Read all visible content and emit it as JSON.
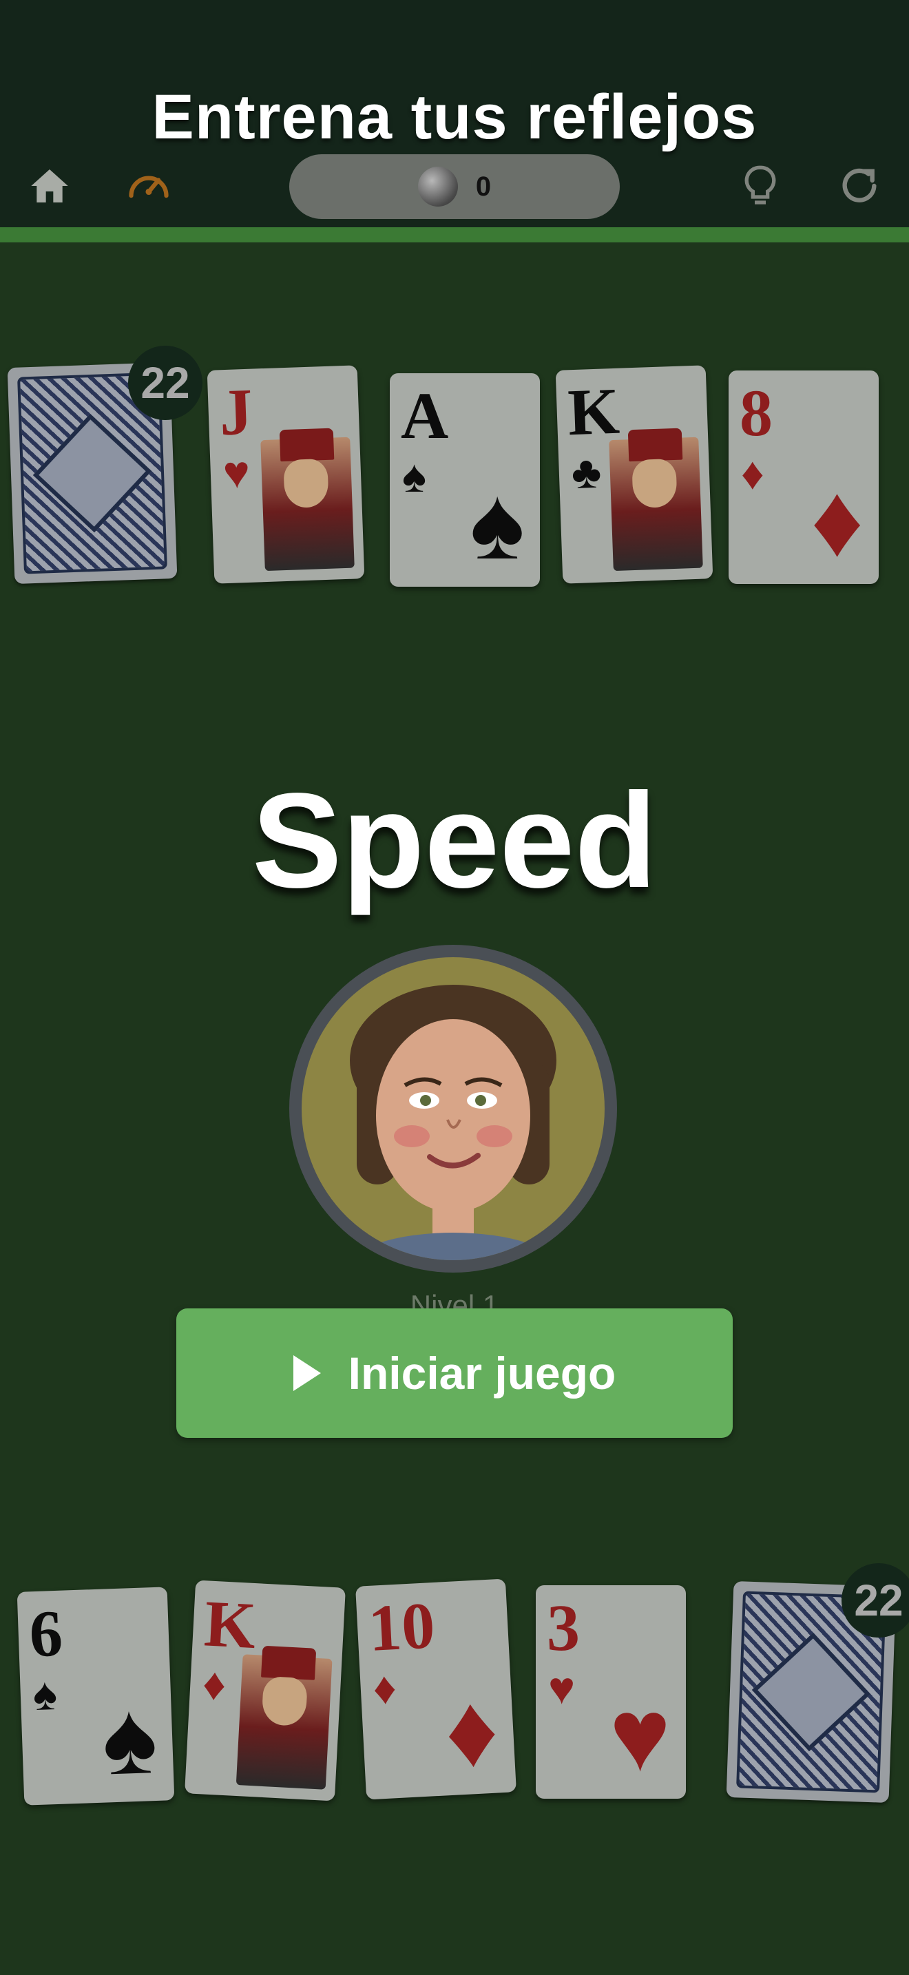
{
  "header": {
    "title": "Entrena tus reflejos",
    "coins": "0",
    "icons": [
      "home-icon",
      "speedometer-icon",
      "coin-icon",
      "lightbulb-icon",
      "refresh-icon"
    ]
  },
  "opponent": {
    "deck_count": "22",
    "cards": [
      {
        "rank": "J",
        "suit": "♥",
        "color": "red",
        "face": true
      },
      {
        "rank": "A",
        "suit": "♠",
        "color": "black",
        "face": false
      },
      {
        "rank": "K",
        "suit": "♣",
        "color": "black",
        "face": true
      },
      {
        "rank": "8",
        "suit": "♦",
        "color": "red",
        "face": false
      }
    ]
  },
  "game": {
    "name": "Speed",
    "level": "Nivel 1",
    "start_label": "Iniciar juego"
  },
  "player": {
    "deck_count": "22",
    "cards": [
      {
        "rank": "6",
        "suit": "♠",
        "color": "black",
        "face": false
      },
      {
        "rank": "K",
        "suit": "♦",
        "color": "red",
        "face": true
      },
      {
        "rank": "10",
        "suit": "♦",
        "color": "red",
        "face": false
      },
      {
        "rank": "3",
        "suit": "♥",
        "color": "red",
        "face": false
      }
    ]
  },
  "colors": {
    "table": "#1e361c",
    "header": "#14251a",
    "accent": "#65af5d"
  }
}
